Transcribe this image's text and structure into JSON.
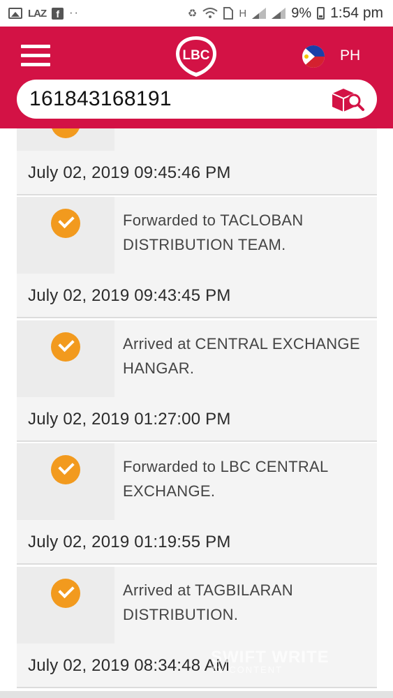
{
  "status_bar": {
    "laz_label": "LAZ",
    "fb_label": "f",
    "dots": "··",
    "network_label": "H",
    "battery": "9%",
    "time": "1:54 pm"
  },
  "header": {
    "logo_text": "LBC",
    "country": "PH",
    "search_value": "161843168191"
  },
  "colors": {
    "brand_red": "#d31245",
    "check_orange": "#f29a1e"
  },
  "icons": [
    "menu-icon",
    "lbc-logo",
    "philippines-flag-icon",
    "parcel-search-icon",
    "checkmark-icon"
  ],
  "tracking": {
    "events": [
      {
        "status": "",
        "date": "July 02, 2019 09:45:46 PM"
      },
      {
        "status": "Forwarded to TACLOBAN DISTRIBUTION TEAM.",
        "date": "July 02, 2019 09:43:45 PM"
      },
      {
        "status": "Arrived at CENTRAL EXCHANGE HANGAR.",
        "date": "July 02, 2019 01:27:00 PM"
      },
      {
        "status": "Forwarded to LBC CENTRAL EXCHANGE.",
        "date": "July 02, 2019 01:19:55 PM"
      },
      {
        "status": "Arrived at TAGBILARAN DISTRIBUTION.",
        "date": "July 02, 2019 08:34:48 AM"
      }
    ]
  },
  "watermark": {
    "line1": "SWIFT WRITE",
    "line2": "TV CONTENT"
  }
}
